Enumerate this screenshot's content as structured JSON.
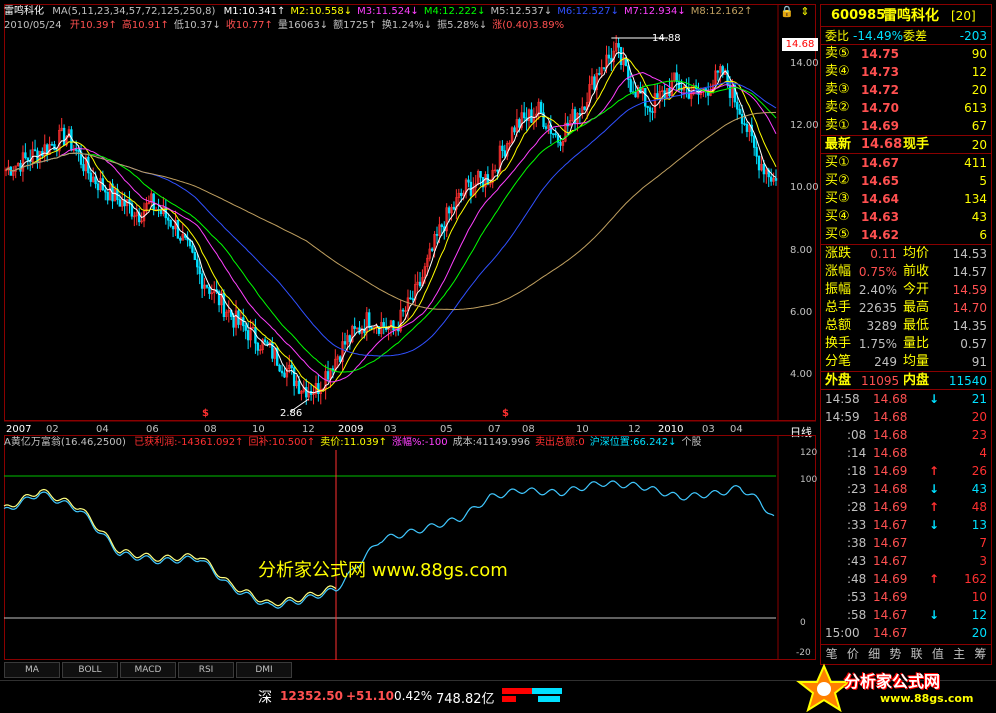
{
  "header": {
    "title": "雷鸣科化",
    "ma_label": "MA(5,11,23,34,57,72,125,250,8)",
    "ma_values": [
      {
        "text": "M1:10.341↑",
        "color": "#ffffff"
      },
      {
        "text": "M2:10.558↓",
        "color": "#ffff00"
      },
      {
        "text": "M3:11.524↓",
        "color": "#ff40ff"
      },
      {
        "text": "M4:12.222↓",
        "color": "#00ff00"
      },
      {
        "text": "M5:12.537↓",
        "color": "#c0c0c0"
      },
      {
        "text": "M6:12.527↓",
        "color": "#3050ff"
      },
      {
        "text": "M7:12.934↓",
        "color": "#ff40ff"
      },
      {
        "text": "M8:12.162↑",
        "color": "#c0a060"
      }
    ],
    "date": "2010/05/24",
    "ohlc": [
      {
        "text": "开10.39↑",
        "color": "#ff5050"
      },
      {
        "text": "高10.91↑",
        "color": "#ff5050"
      },
      {
        "text": "低10.37↓",
        "color": "#c0c0c0"
      },
      {
        "text": "收10.77↑",
        "color": "#ff5050"
      },
      {
        "text": "量16063↓",
        "color": "#c0c0c0"
      },
      {
        "text": "额1725↑",
        "color": "#c0c0c0"
      },
      {
        "text": "换1.24%↓",
        "color": "#c0c0c0"
      },
      {
        "text": "振5.28%↓",
        "color": "#c0c0c0"
      },
      {
        "text": "涨(0.40)3.89%",
        "color": "#ff5050"
      }
    ],
    "lock_icon": "lock-icon",
    "scroll_icon": "updown-icon"
  },
  "price_axis": {
    "labels": [
      "14.00",
      "12.00",
      "10.00",
      "8.00",
      "6.00",
      "4.00"
    ],
    "current_price_tag": "14.68",
    "high_mark": "14.88",
    "low_mark": "2.86"
  },
  "time_axis": {
    "labels": [
      "2007",
      "02",
      "04",
      "06",
      "08",
      "10",
      "12",
      "2009",
      "03",
      "05",
      "07",
      "08",
      "10",
      "12",
      "2010",
      "03",
      "04"
    ],
    "period_label": "日线"
  },
  "indicator": {
    "name": "A黄亿万富翁(16.46,2500)",
    "items": [
      {
        "text": "已获利润:-14361.092↑",
        "color": "#ff3030"
      },
      {
        "text": "回补:10.500↑",
        "color": "#ff3030"
      },
      {
        "text": "卖价:11.039↑",
        "color": "#ffff00"
      },
      {
        "text": "涨幅%:-100",
        "color": "#ff40ff"
      },
      {
        "text": "成本:41149.996",
        "color": "#c0c0c0"
      },
      {
        "text": "卖出总额:0",
        "color": "#ff3030"
      },
      {
        "text": "沪深位置:66.242↓",
        "color": "#00e0ff"
      },
      {
        "text": "个股",
        "color": "#c0c0c0"
      }
    ],
    "axis_labels": [
      "120",
      "100",
      "0",
      "-20"
    ],
    "watermark": "分析家公式网 www.88gs.com"
  },
  "tabs": [
    "MA",
    "BOLL",
    "MACD",
    "RSI",
    "DMI"
  ],
  "quote": {
    "code": "600985",
    "name": "雷鸣科化",
    "suffix": "[20]",
    "wei_bi_label": "委比",
    "wei_bi": "-14.49%",
    "wei_cha_label": "委差",
    "wei_cha": "-203",
    "sell": [
      {
        "label": "卖⑤",
        "price": "14.75",
        "vol": "90"
      },
      {
        "label": "卖④",
        "price": "14.73",
        "vol": "12"
      },
      {
        "label": "卖③",
        "price": "14.72",
        "vol": "20"
      },
      {
        "label": "卖②",
        "price": "14.70",
        "vol": "613"
      },
      {
        "label": "卖①",
        "price": "14.69",
        "vol": "67"
      }
    ],
    "latest_label": "最新",
    "latest": "14.68",
    "xianshou_label": "现手",
    "xianshou": "20",
    "buy": [
      {
        "label": "买①",
        "price": "14.67",
        "vol": "411"
      },
      {
        "label": "买②",
        "price": "14.65",
        "vol": "5"
      },
      {
        "label": "买③",
        "price": "14.64",
        "vol": "134"
      },
      {
        "label": "买④",
        "price": "14.63",
        "vol": "43"
      },
      {
        "label": "买⑤",
        "price": "14.62",
        "vol": "6"
      }
    ],
    "stats": [
      {
        "l1": "涨跌",
        "v1": "0.11",
        "c1": "#ff5050",
        "l2": "均价",
        "v2": "14.53",
        "c2": "#c0c0c0"
      },
      {
        "l1": "涨幅",
        "v1": "0.75%",
        "c1": "#ff5050",
        "l2": "前收",
        "v2": "14.57",
        "c2": "#c0c0c0"
      },
      {
        "l1": "振幅",
        "v1": "2.40%",
        "c1": "#c0c0c0",
        "l2": "今开",
        "v2": "14.59",
        "c2": "#ff5050"
      },
      {
        "l1": "总手",
        "v1": "22635",
        "c1": "#c0c0c0",
        "l2": "最高",
        "v2": "14.70",
        "c2": "#ff5050"
      },
      {
        "l1": "总额",
        "v1": "3289",
        "c1": "#c0c0c0",
        "l2": "最低",
        "v2": "14.35",
        "c2": "#c0c0c0"
      },
      {
        "l1": "换手",
        "v1": "1.75%",
        "c1": "#c0c0c0",
        "l2": "量比",
        "v2": "0.57",
        "c2": "#c0c0c0"
      },
      {
        "l1": "分笔",
        "v1": "249",
        "c1": "#c0c0c0",
        "l2": "均量",
        "v2": "91",
        "c2": "#c0c0c0"
      }
    ],
    "outer_label": "外盘",
    "outer": "11095",
    "inner_label": "内盘",
    "inner": "11540",
    "ticks": [
      {
        "t": "14:58",
        "p": "14.68",
        "a": "↓",
        "ac": "#00e0ff",
        "v": "21",
        "vc": "#00e0ff"
      },
      {
        "t": "14:59",
        "p": "14.68",
        "a": "",
        "ac": "#ff3030",
        "v": "20",
        "vc": "#ff3030"
      },
      {
        "t": ":08",
        "p": "14.68",
        "a": "",
        "ac": "#ff3030",
        "v": "23",
        "vc": "#ff3030"
      },
      {
        "t": ":14",
        "p": "14.68",
        "a": "",
        "ac": "#ff3030",
        "v": "4",
        "vc": "#ff3030"
      },
      {
        "t": ":18",
        "p": "14.69",
        "a": "↑",
        "ac": "#ff3030",
        "v": "26",
        "vc": "#ff3030"
      },
      {
        "t": ":23",
        "p": "14.68",
        "a": "↓",
        "ac": "#00e0ff",
        "v": "43",
        "vc": "#00e0ff"
      },
      {
        "t": ":28",
        "p": "14.69",
        "a": "↑",
        "ac": "#ff3030",
        "v": "48",
        "vc": "#ff3030"
      },
      {
        "t": ":33",
        "p": "14.67",
        "a": "↓",
        "ac": "#00e0ff",
        "v": "13",
        "vc": "#00e0ff"
      },
      {
        "t": ":38",
        "p": "14.67",
        "a": "",
        "ac": "#ff3030",
        "v": "7",
        "vc": "#ff3030"
      },
      {
        "t": ":43",
        "p": "14.67",
        "a": "",
        "ac": "#ff3030",
        "v": "3",
        "vc": "#ff3030"
      },
      {
        "t": ":48",
        "p": "14.69",
        "a": "↑",
        "ac": "#ff3030",
        "v": "162",
        "vc": "#ff3030"
      },
      {
        "t": ":53",
        "p": "14.69",
        "a": "",
        "ac": "#ff3030",
        "v": "10",
        "vc": "#ff3030"
      },
      {
        "t": ":58",
        "p": "14.67",
        "a": "↓",
        "ac": "#00e0ff",
        "v": "12",
        "vc": "#00e0ff"
      },
      {
        "t": "15:00",
        "p": "14.67",
        "a": "",
        "ac": "#00e0ff",
        "v": "20",
        "vc": "#00e0ff"
      }
    ],
    "bottom_tabs": [
      "笔",
      "价",
      "细",
      "势",
      "联",
      "值",
      "主",
      "筹"
    ]
  },
  "status": {
    "market": "深",
    "index": "12352.50",
    "change": "+51.10",
    "pct": "0.42%",
    "amount": "748.82亿"
  },
  "logo": {
    "text": "分析家公式网",
    "url": "www.88gs.com"
  },
  "chart_data": {
    "type": "line",
    "title": "雷鸣科化",
    "price_ylim": [
      2.86,
      14.88
    ],
    "x": [
      "2007",
      "02",
      "04",
      "06",
      "08",
      "10",
      "12",
      "2009",
      "03",
      "05",
      "07",
      "08",
      "10",
      "12",
      "2010",
      "03",
      "04"
    ],
    "series": [
      {
        "name": "M1",
        "color": "#ffffff"
      },
      {
        "name": "M2",
        "color": "#ffff00"
      },
      {
        "name": "M3",
        "color": "#ff40ff"
      },
      {
        "name": "M4",
        "color": "#00ff00"
      },
      {
        "name": "M6",
        "color": "#3050ff"
      },
      {
        "name": "M8",
        "color": "#c0a060"
      }
    ],
    "indicator_ylim": [
      -20,
      120
    ]
  }
}
